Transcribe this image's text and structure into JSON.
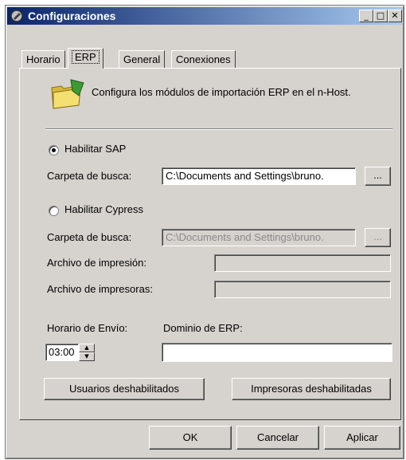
{
  "window": {
    "title": "Configuraciones",
    "controls": {
      "minimize": "_",
      "maximize": "□",
      "close": "✕"
    }
  },
  "tabs": [
    {
      "label": "Horario",
      "active": false
    },
    {
      "label": "ERP",
      "active": true
    },
    {
      "label": "General",
      "active": false
    },
    {
      "label": "Conexiones",
      "active": false
    }
  ],
  "erp": {
    "description": "Configura los módulos de importación ERP en el n-Host.",
    "sap": {
      "label": "Habilitar SAP",
      "checked": true,
      "folder_label": "Carpeta de busca:",
      "folder_value": "C:\\Documents and Settings\\bruno.",
      "browse_label": "..."
    },
    "cypress": {
      "label": "Habilitar Cypress",
      "checked": false,
      "folder_label": "Carpeta de busca:",
      "folder_value": "C:\\Documents and Settings\\bruno.",
      "browse_label": "...",
      "print_file_label": "Archivo de impresión:",
      "print_file_value": "",
      "printers_file_label": "Archivo de impresoras:",
      "printers_file_value": ""
    },
    "send_time_label": "Horario de Envío:",
    "send_time_value": "03:00",
    "erp_domain_label": "Dominio de ERP:",
    "erp_domain_value": "",
    "disabled_users_button": "Usuarios deshabilitados",
    "disabled_printers_button": "Impresoras deshabilitadas"
  },
  "footer": {
    "ok": "OK",
    "cancel": "Cancelar",
    "apply": "Aplicar"
  }
}
